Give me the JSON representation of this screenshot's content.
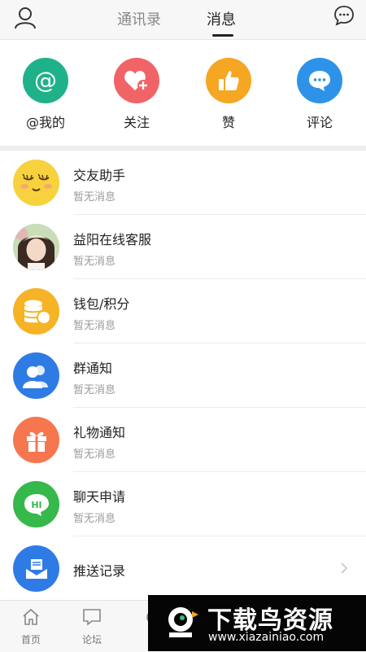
{
  "header": {
    "tabs": [
      {
        "label": "通讯录",
        "active": false
      },
      {
        "label": "消息",
        "active": true
      }
    ],
    "icons": [
      "profile-icon",
      "chat-bubble-icon"
    ]
  },
  "quick_actions": [
    {
      "label": "@我的",
      "icon": "at-icon",
      "color": "#1fb28a"
    },
    {
      "label": "关注",
      "icon": "heart-plus-icon",
      "color": "#f06468"
    },
    {
      "label": "赞",
      "icon": "thumbs-up-icon",
      "color": "#f5a623"
    },
    {
      "label": "评论",
      "icon": "comment-icon",
      "color": "#2e93e8"
    }
  ],
  "messages": [
    {
      "title": "交友助手",
      "subtitle": "暂无消息",
      "icon": "smiley-face-icon",
      "color": "#f7d23e"
    },
    {
      "title": "益阳在线客服",
      "subtitle": "暂无消息",
      "icon": "photo-avatar",
      "color": "#a9c9a0"
    },
    {
      "title": "钱包/积分",
      "subtitle": "暂无消息",
      "icon": "coin-stack-icon",
      "color": "#f5b325"
    },
    {
      "title": "群通知",
      "subtitle": "暂无消息",
      "icon": "group-users-icon",
      "color": "#2f7be6"
    },
    {
      "title": "礼物通知",
      "subtitle": "暂无消息",
      "icon": "gift-icon",
      "color": "#f6764f"
    },
    {
      "title": "聊天申请",
      "subtitle": "暂无消息",
      "icon": "hi-bubble-icon",
      "color": "#36b84b"
    },
    {
      "title": "推送记录",
      "subtitle": "",
      "icon": "mail-tray-icon",
      "color": "#2f7be6"
    }
  ],
  "bottom_nav": [
    {
      "label": "首页",
      "icon": "home-icon"
    },
    {
      "label": "论坛",
      "icon": "forum-icon"
    }
  ],
  "watermark": {
    "title": "下载鸟资源",
    "url": "www.xiazainiao.com"
  }
}
